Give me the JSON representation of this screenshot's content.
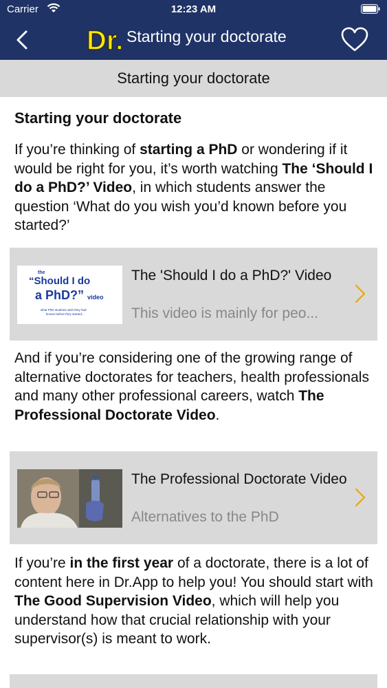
{
  "status_bar": {
    "carrier": "Carrier",
    "time": "12:23 AM"
  },
  "nav": {
    "logo_text": "Dr.",
    "title": "Starting your doctorate"
  },
  "subheader": {
    "title": "Starting your doctorate"
  },
  "section_title": "Starting your doctorate",
  "intro": {
    "p1": "If you’re thinking of ",
    "b1": "starting a PhD",
    "p2": " or wondering if it would be right for you, it’s worth watching ",
    "b2": "The ‘Should I do a PhD?’ Video",
    "p3": ", in which students answer the question ‘What do you wish you’d known before you started?’"
  },
  "cards": [
    {
      "title": "The 'Should I do a PhD?' Video",
      "subtitle": "This video is mainly for peo...",
      "thumb": {
        "small": "the",
        "line1": "“Should I do",
        "line2": "a PhD?”",
        "tag": "video",
        "caption1": "what PhD students wish they had",
        "caption2": "known before they started..."
      }
    },
    {
      "title": "The Professional Doctorate Video",
      "subtitle": "Alternatives to the PhD"
    }
  ],
  "para2": {
    "p1": "And if you’re considering one of the growing range of alternative doctorates for teachers, health professionals and many other professional careers, watch ",
    "b1": "The Professional Doctorate Video",
    "p2": "."
  },
  "para3": {
    "p1": "If you’re ",
    "b1": "in the first year",
    "p2": " of a doctorate, there is a lot of content here in Dr.App to help you!  You should start with ",
    "b2": "The Good Supervision Video",
    "p3": ", which will help you understand how that crucial relationship with your supervisor(s) is meant to work."
  },
  "colors": {
    "navbar": "#1f3366",
    "logo_yellow": "#ffe800",
    "chevron": "#f0a500",
    "card_bg": "#d9d9d9",
    "thumb_blue": "#1a3a9c"
  }
}
